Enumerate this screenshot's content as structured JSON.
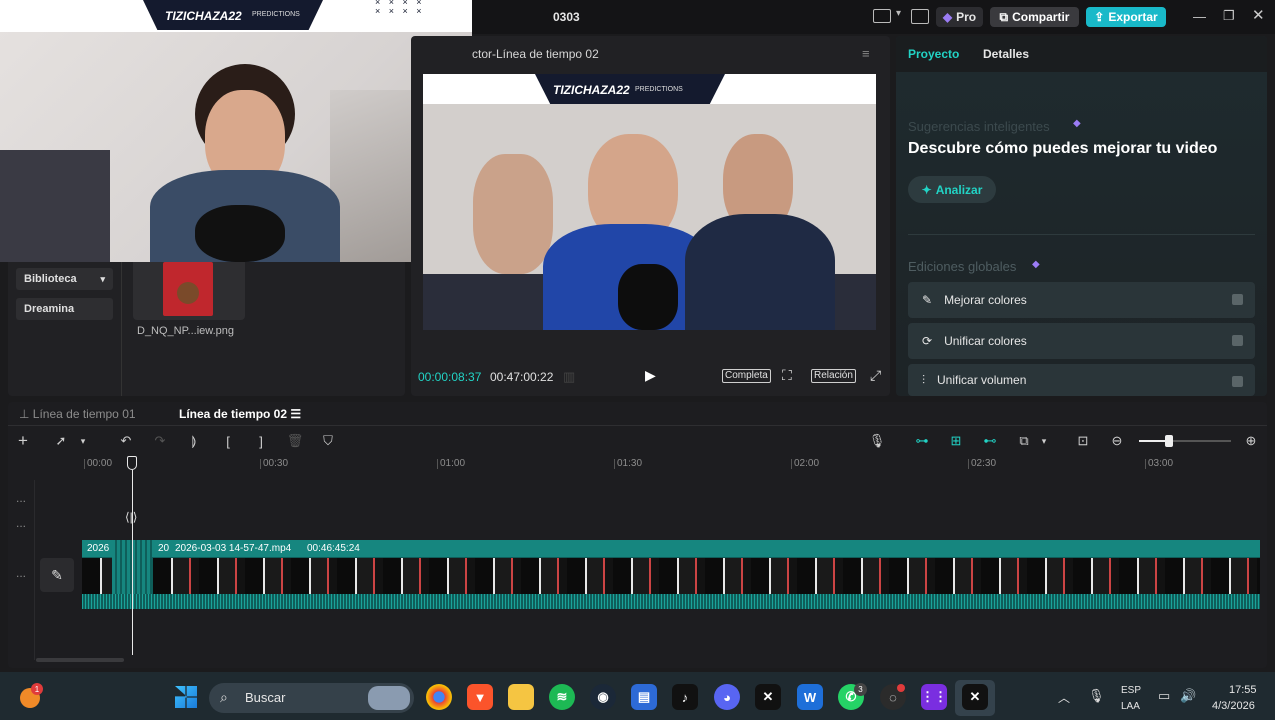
{
  "window": {
    "title": "0303",
    "pro_label": "Pro",
    "share_label": "Compartir",
    "export_label": "Exportar"
  },
  "webcam": {
    "channel_name": "TIZICHAZA22",
    "badge": "PREDICTIONS"
  },
  "media": {
    "tabs": [
      "Biblioteca",
      "Dreamina"
    ],
    "file_name": "D_NQ_NP...iew.png"
  },
  "player": {
    "title": "ctor-Línea de tiempo 02",
    "current_time": "00:00:08:37",
    "total_time": "00:47:00:22",
    "full_label": "Completa",
    "ratio_label": "Relación",
    "overlay_channel": "TIZICHAZA22",
    "overlay_badge": "PREDICTIONS"
  },
  "right_panel": {
    "tabs": [
      "Proyecto",
      "Detalles"
    ],
    "smart_label": "Sugerencias inteligentes",
    "headline": "Descubre cómo puedes mejorar tu video",
    "analyze_label": "Analizar",
    "global_label": "Ediciones globales",
    "features": [
      "Mejorar colores",
      "Unificar colores",
      "Unificar volumen"
    ]
  },
  "timeline": {
    "tabs": [
      "Línea de tiempo 01",
      "Línea de tiempo 02"
    ],
    "ruler": [
      "00:00",
      "00:30",
      "01:00",
      "01:30",
      "02:00",
      "02:30",
      "03:00"
    ],
    "clip_short": "2026",
    "clip_short2": "20",
    "clip_name": "2026-03-03 14-57-47.mp4",
    "clip_duration": "00:46:45:24",
    "track_dots": [
      "...",
      "...",
      "..."
    ]
  },
  "taskbar": {
    "search_label": "Buscar",
    "notif_count": "1",
    "whatsapp_count": "3",
    "lang1": "ESP",
    "lang2": "LAA",
    "time": "17:55",
    "date": "4/3/2026"
  },
  "colors": {
    "accent": "#22d3c5",
    "teal_clip": "#16867f",
    "export": "#19b9c9"
  }
}
